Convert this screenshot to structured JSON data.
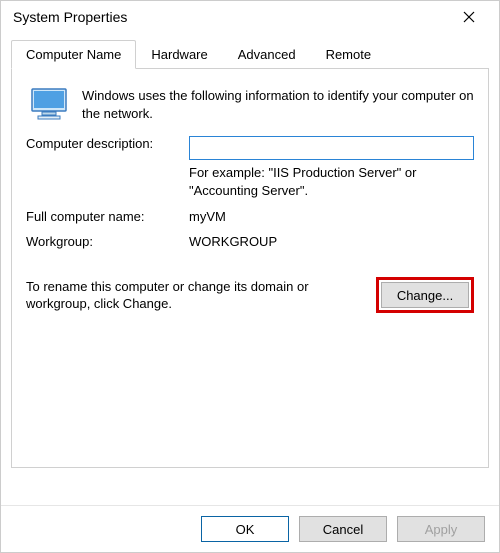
{
  "window": {
    "title": "System Properties"
  },
  "tabs": {
    "computer_name": "Computer Name",
    "hardware": "Hardware",
    "advanced": "Advanced",
    "remote": "Remote"
  },
  "panel": {
    "intro": "Windows uses the following information to identify your computer on the network.",
    "desc_label": "Computer description:",
    "desc_value": "",
    "desc_hint": "For example: \"IIS Production Server\" or \"Accounting Server\".",
    "fullname_label": "Full computer name:",
    "fullname_value": "myVM",
    "workgroup_label": "Workgroup:",
    "workgroup_value": "WORKGROUP",
    "rename_text": "To rename this computer or change its domain or workgroup, click Change.",
    "change_button": "Change..."
  },
  "footer": {
    "ok": "OK",
    "cancel": "Cancel",
    "apply": "Apply"
  }
}
